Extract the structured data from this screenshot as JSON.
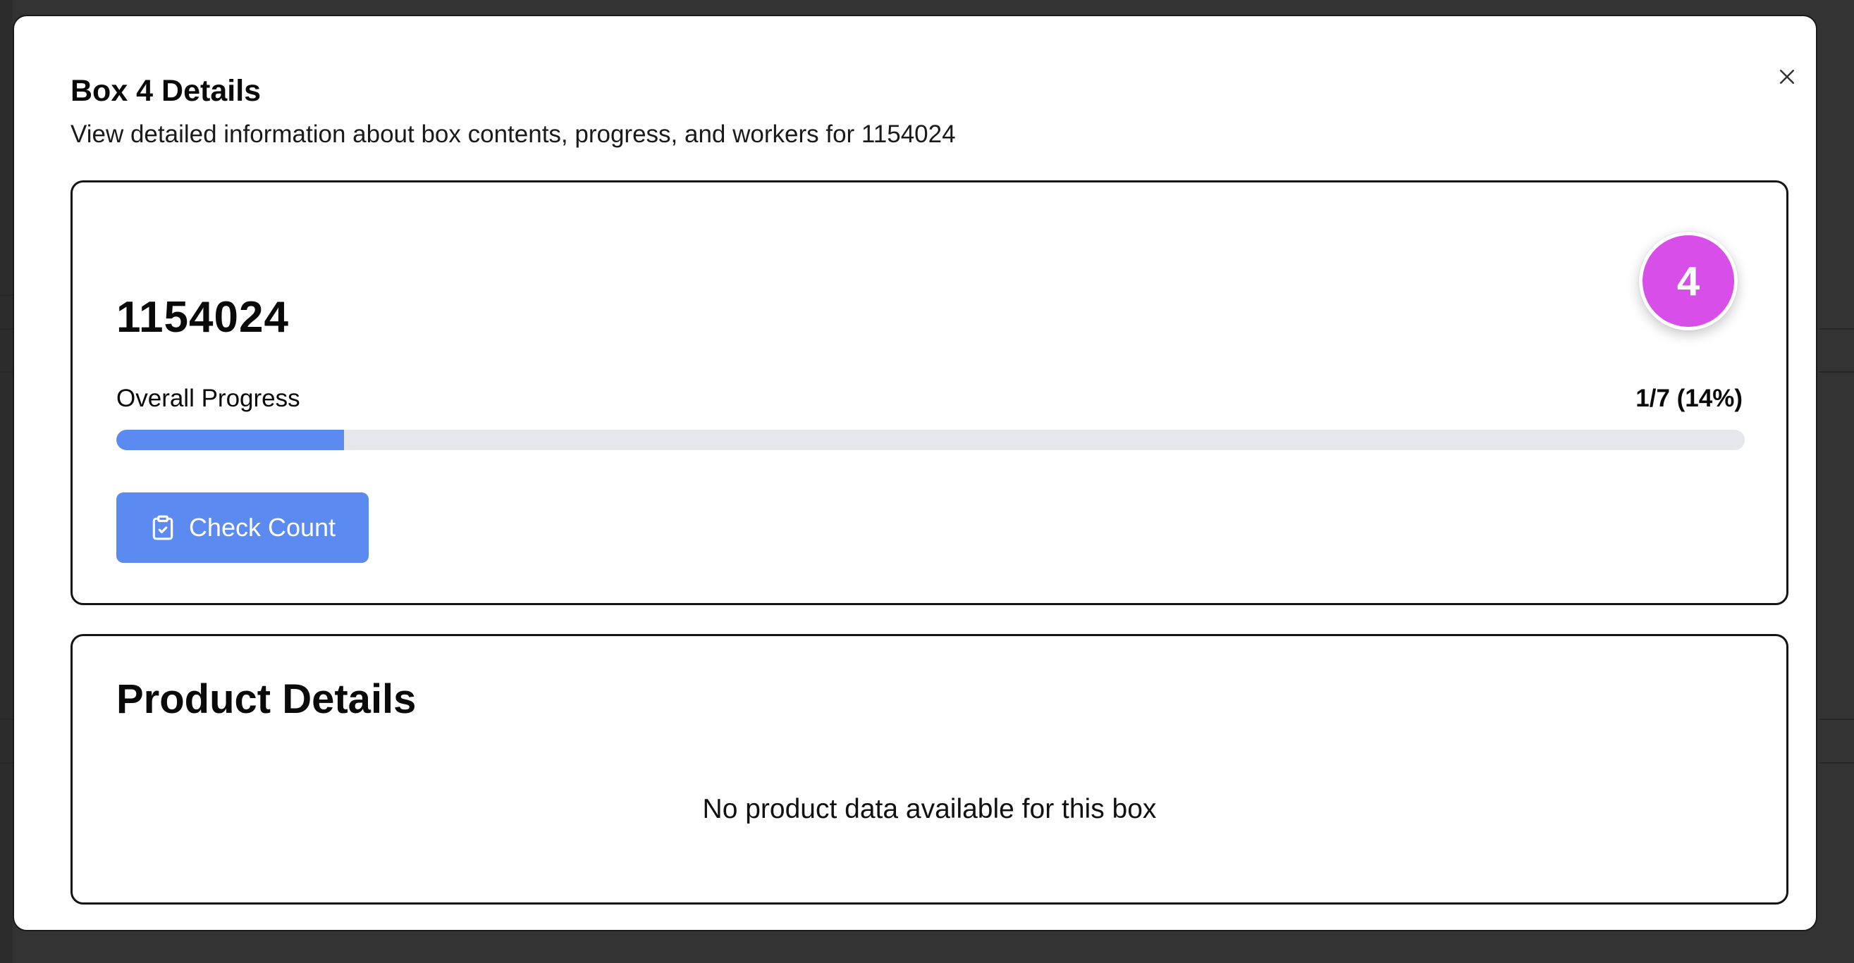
{
  "modal": {
    "title": "Box 4 Details",
    "subtitle": "View detailed information about box contents, progress, and workers for 1154024",
    "close_icon": "close-icon"
  },
  "summary": {
    "box_number": "1154024",
    "badge": "4",
    "badge_color": "#d74ee8",
    "progress_label": "Overall Progress",
    "progress_text": "1/7 (14%)",
    "progress_fraction": 0.14,
    "progress_color": "#5b8af0",
    "check_button": {
      "label": "Check Count",
      "icon": "clipboard-check-icon"
    }
  },
  "products": {
    "title": "Product Details",
    "empty_message": "No product data available for this box"
  }
}
